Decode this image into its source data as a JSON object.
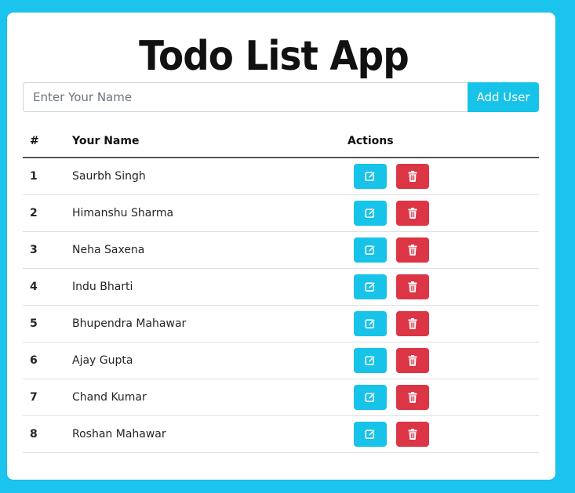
{
  "app": {
    "title": "Todo List App"
  },
  "form": {
    "input_placeholder": "Enter Your Name",
    "input_value": "",
    "add_button_label": "Add User"
  },
  "table": {
    "headers": {
      "number": "#",
      "name": "Your Name",
      "actions": "Actions"
    },
    "rows": [
      {
        "num": "1",
        "name": "Saurbh Singh"
      },
      {
        "num": "2",
        "name": "Himanshu Sharma"
      },
      {
        "num": "3",
        "name": "Neha Saxena"
      },
      {
        "num": "4",
        "name": "Indu Bharti"
      },
      {
        "num": "5",
        "name": "Bhupendra Mahawar"
      },
      {
        "num": "6",
        "name": "Ajay Gupta"
      },
      {
        "num": "7",
        "name": "Chand Kumar"
      },
      {
        "num": "8",
        "name": "Roshan Mahawar"
      }
    ]
  },
  "icons": {
    "edit": "edit-icon",
    "delete": "trash-icon"
  },
  "colors": {
    "background": "#1bc4ec",
    "primary": "#17c3e8",
    "danger": "#dc3545"
  }
}
